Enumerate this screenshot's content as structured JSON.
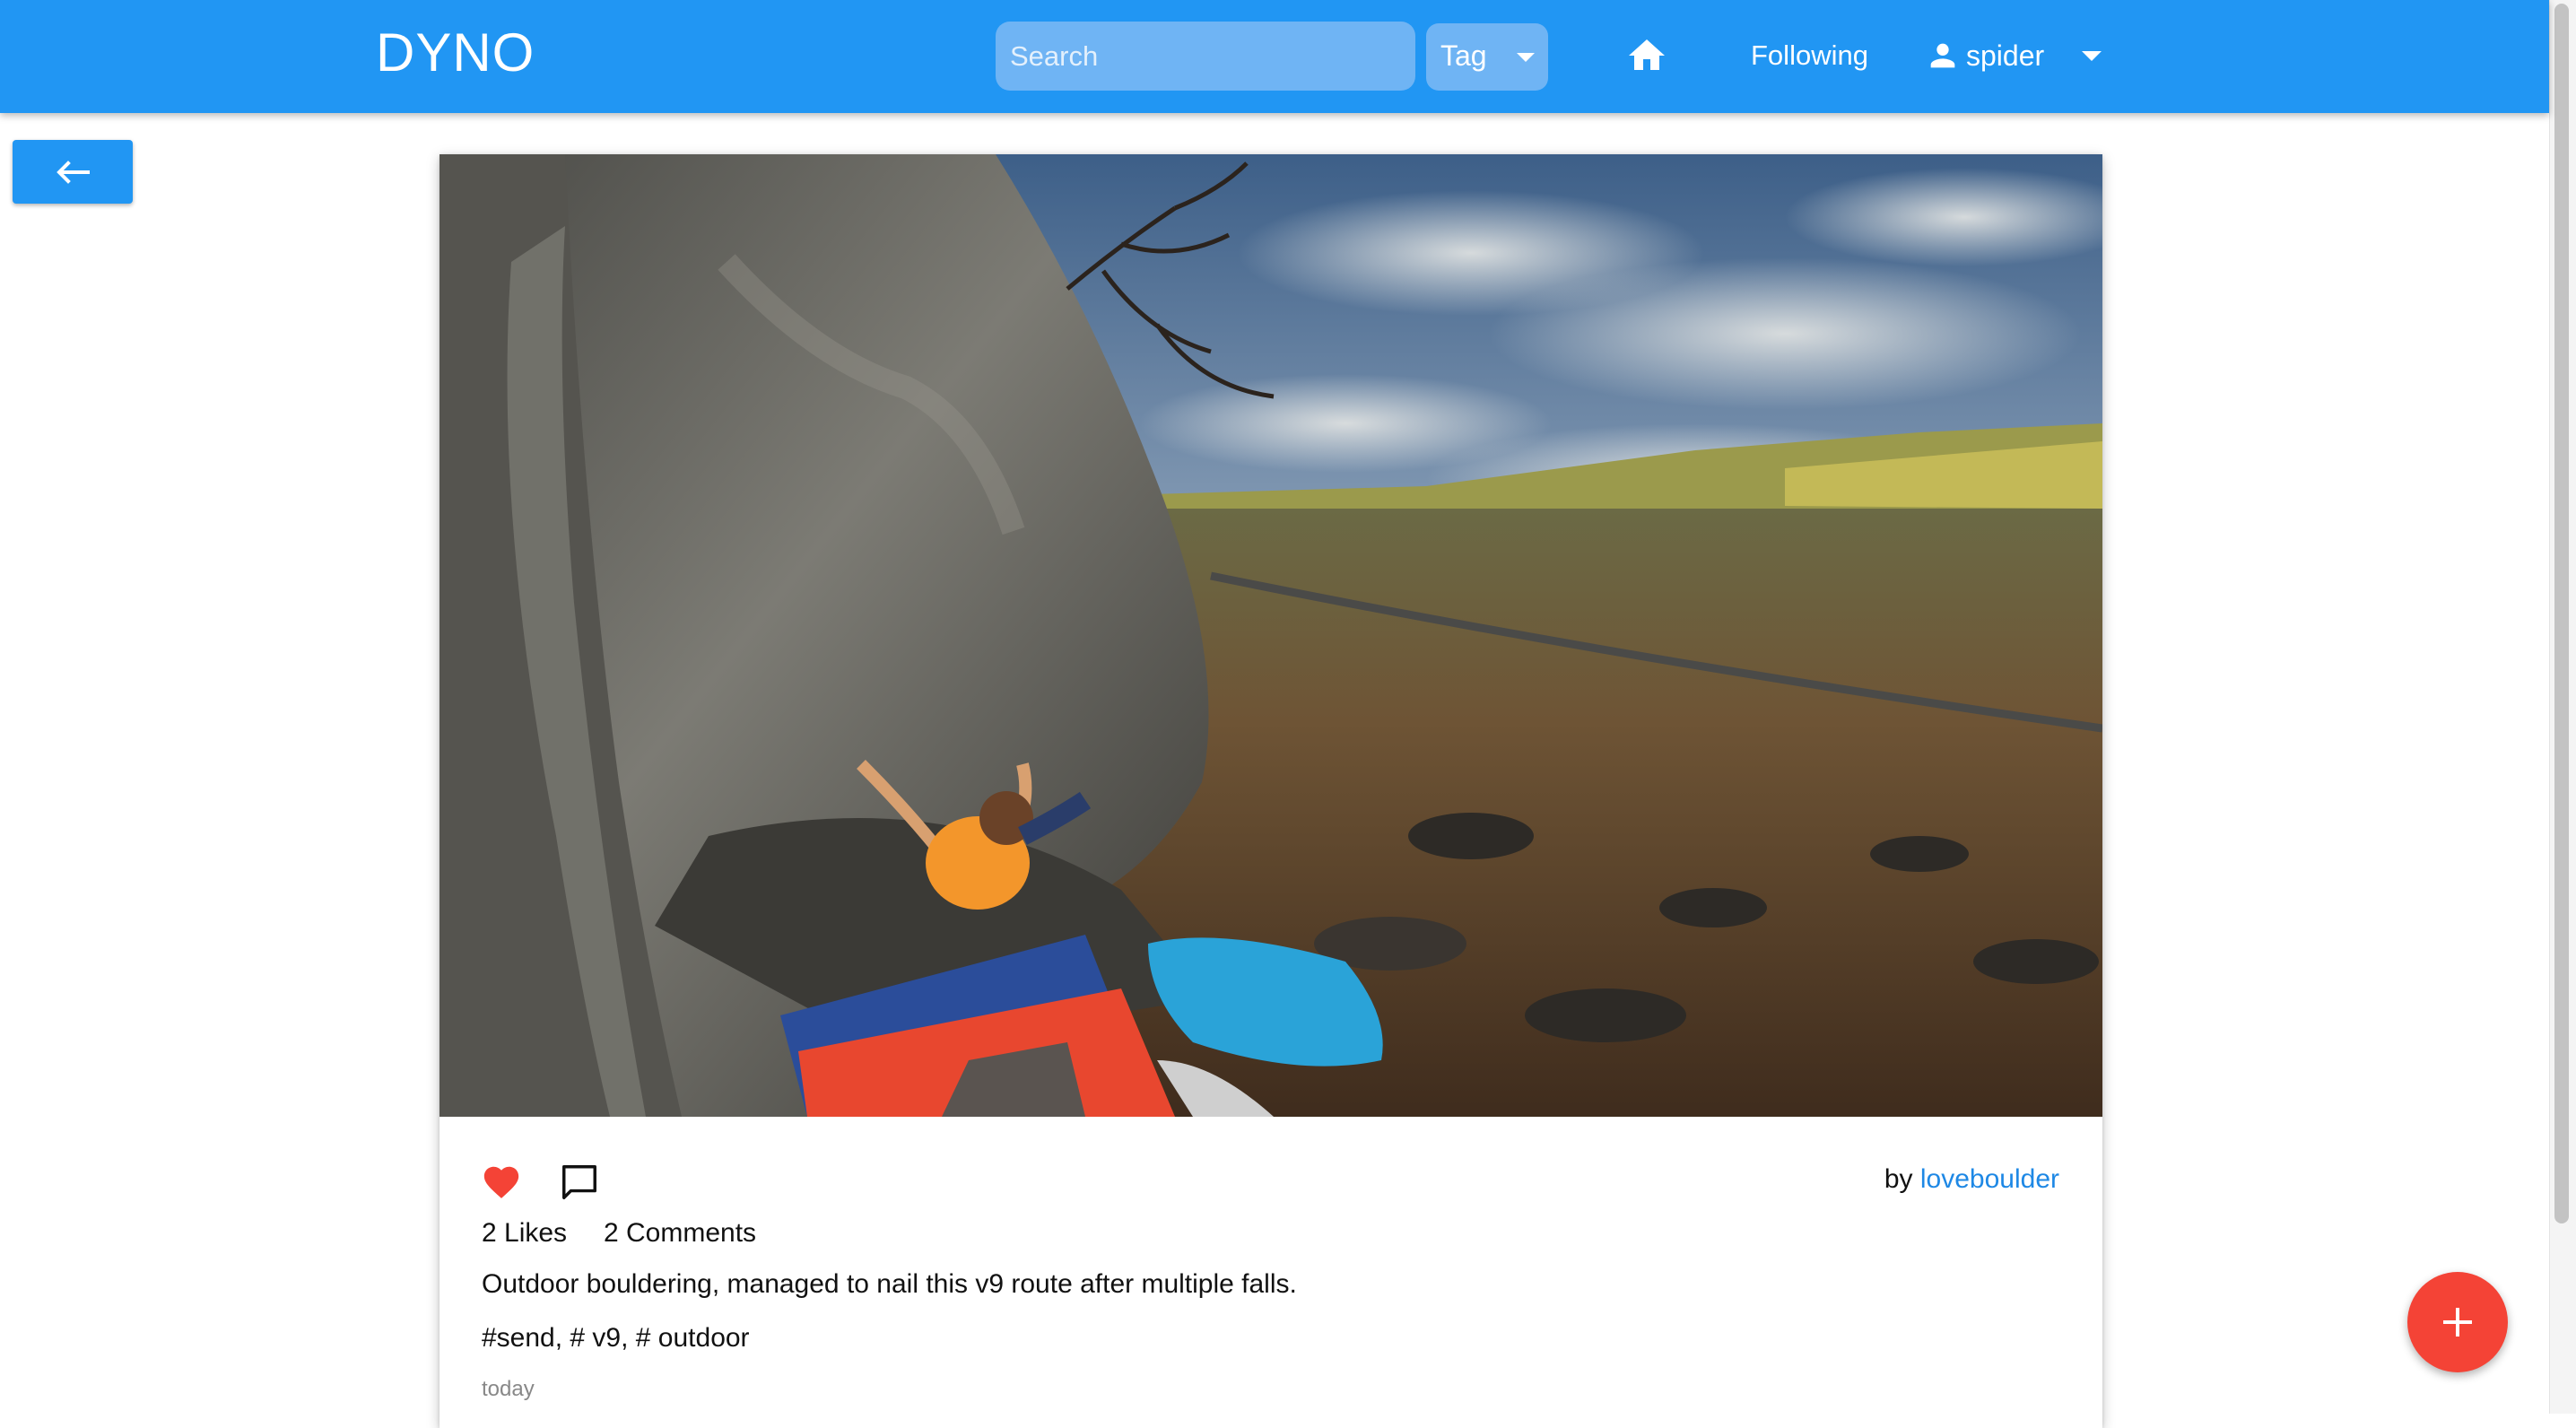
{
  "header": {
    "brand": "DYNO",
    "search_placeholder": "Search",
    "tag_label": "Tag",
    "following_label": "Following",
    "username": "spider"
  },
  "post": {
    "author_prefix": "by ",
    "author": "loveboulder",
    "likes_text": "2 Likes",
    "comments_text": "2 Comments",
    "caption": "Outdoor bouldering, managed to nail this v9 route after multiple falls.",
    "tags_text": "#send, # v9, # outdoor",
    "time": "today",
    "liked": true
  },
  "icons": {
    "back": "arrow-left-icon",
    "home": "home-icon",
    "user": "person-icon",
    "like": "heart-icon",
    "comment": "comment-icon",
    "add": "plus-icon"
  },
  "colors": {
    "primary": "#2196f3",
    "like": "#f44336",
    "fab": "#f44336",
    "link": "#1e88e5"
  }
}
